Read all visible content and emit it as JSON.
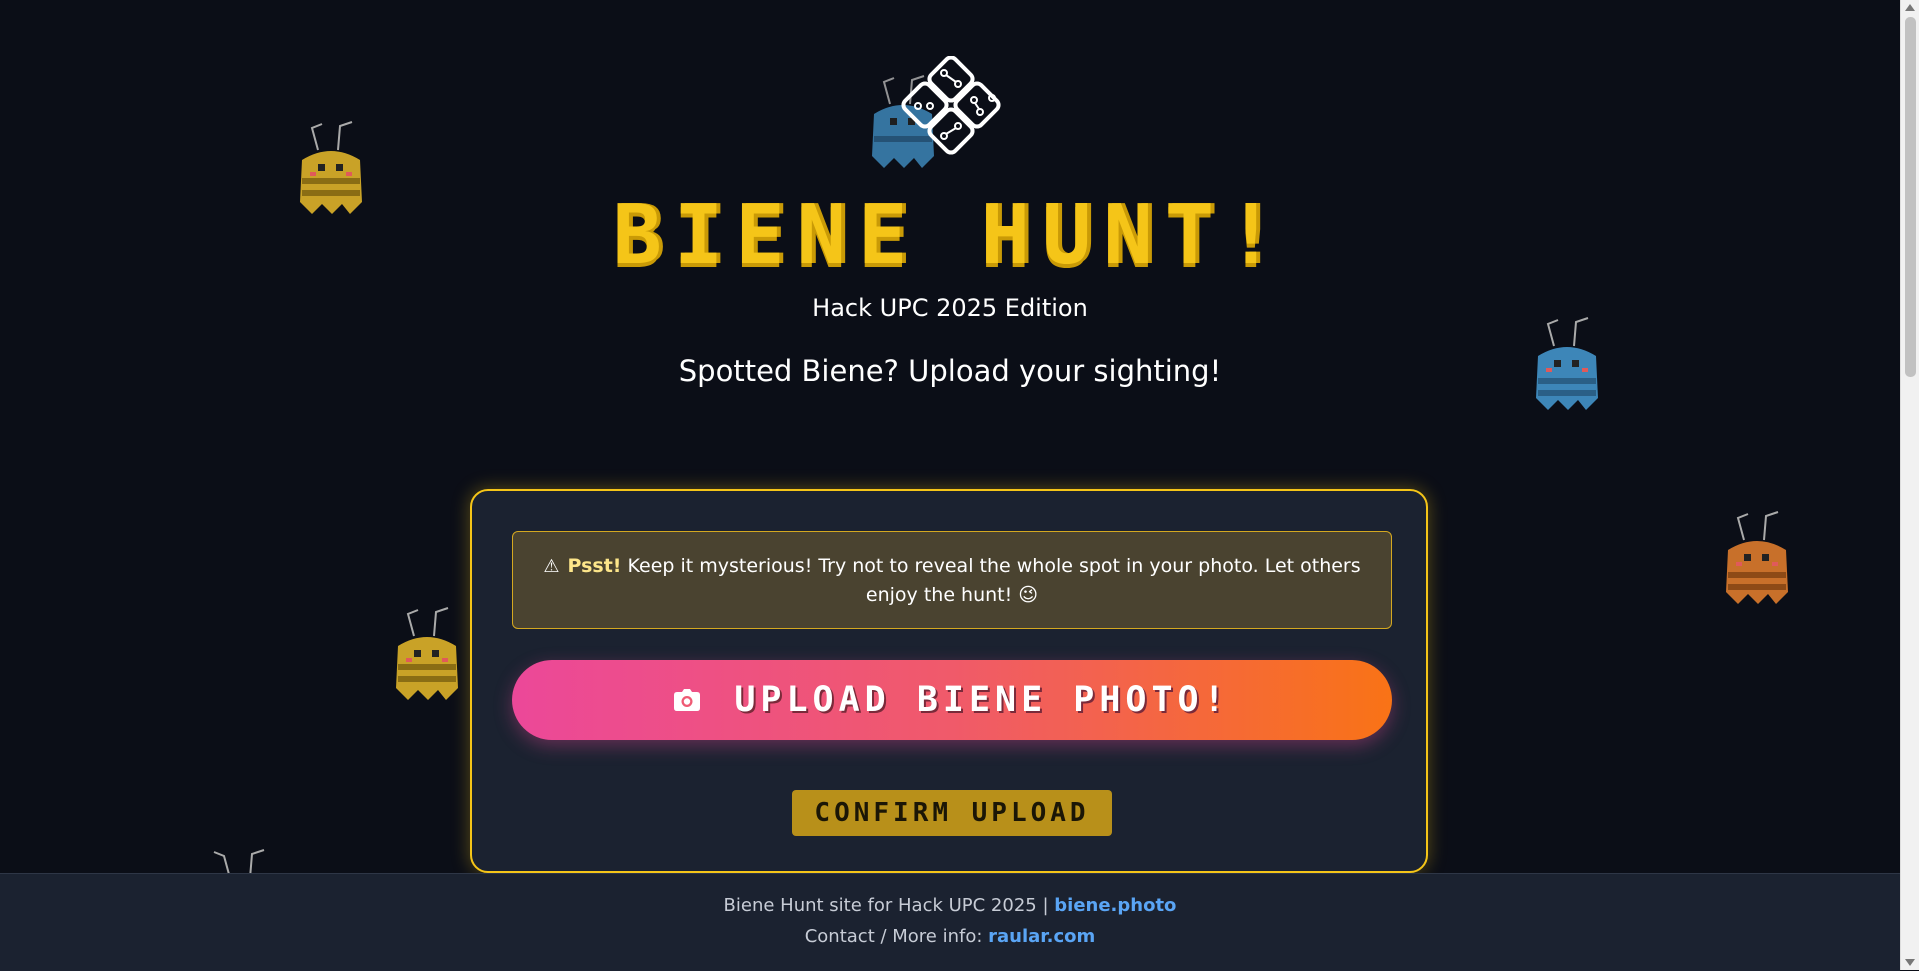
{
  "header": {
    "title": "BIENE HUNT!",
    "subtitle": "Hack UPC 2025 Edition",
    "tagline": "Spotted Biene? Upload your sighting!"
  },
  "notice": {
    "icon": "warning-icon",
    "emphasis": "Psst!",
    "text": " Keep it mysterious! Try not to reveal the whole spot in your photo. Let others enjoy the hunt! 😉"
  },
  "buttons": {
    "upload_label": "UPLOAD BIENE PHOTO!",
    "upload_icon": "camera-icon",
    "confirm_label": "CONFIRM UPLOAD"
  },
  "footer": {
    "line1_text": "Biene Hunt site for Hack UPC 2025 | ",
    "line1_link": "biene.photo",
    "line2_text": "Contact / More info: ",
    "line2_link": "raular.com"
  },
  "colors": {
    "background": "#0b0e17",
    "accent_yellow": "#f5c518",
    "gradient_start": "#ec4899",
    "gradient_end": "#f97316",
    "link": "#5aa5f5"
  },
  "decorations": {
    "bee_colors": [
      "yellow",
      "blue",
      "orange"
    ]
  }
}
